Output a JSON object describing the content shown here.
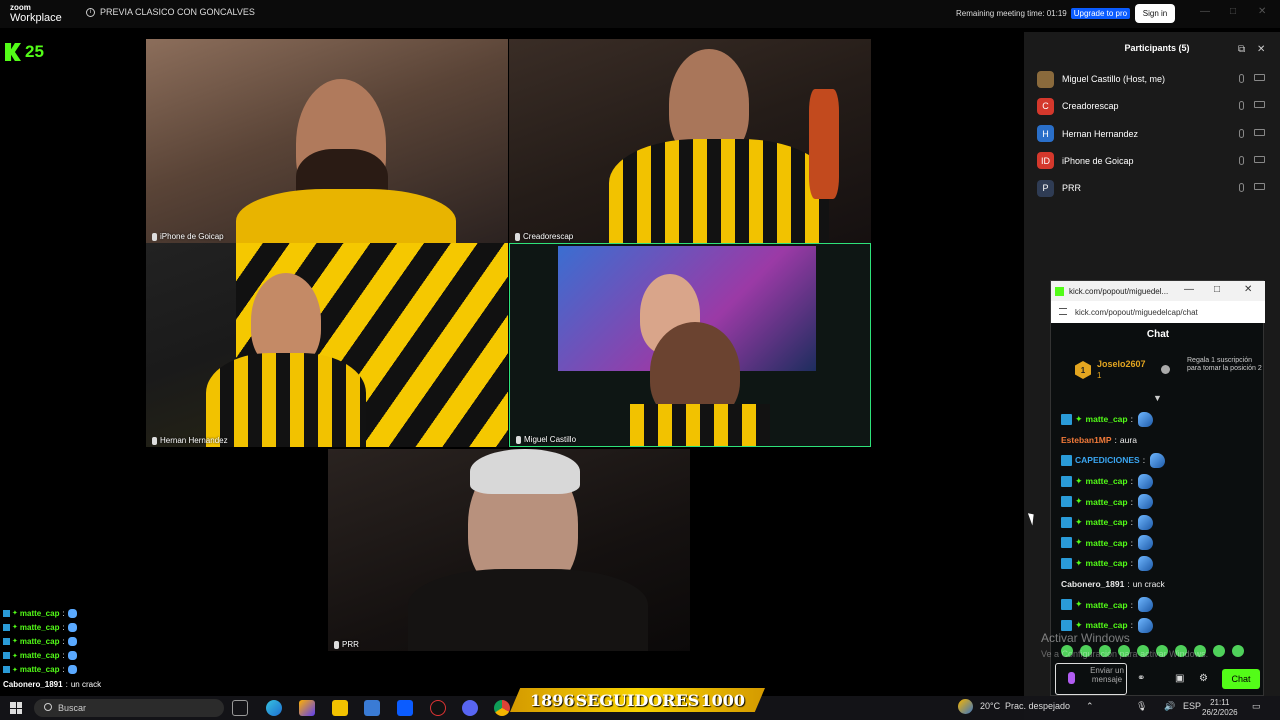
{
  "zoom": {
    "logo_top": "zoom",
    "logo_bottom": "Workplace",
    "meeting_title": "PREVIA CLASICO CON GONCALVES",
    "remaining": "Remaining meeting time: 01:19",
    "upgrade": "Upgrade to pro",
    "sign_in": "Sign in"
  },
  "overlay": {
    "kick_count": "25",
    "banner_left": "1896",
    "banner_middle": "SEGUIDORES",
    "banner_right": "1000"
  },
  "tiles": [
    {
      "name": "iPhone de Goicap"
    },
    {
      "name": "Creadorescap"
    },
    {
      "name": "Hernan Hernandez"
    },
    {
      "name": "Miguel Castillo"
    },
    {
      "name": "PRR"
    }
  ],
  "participants": {
    "title": "Participants (5)",
    "list": [
      {
        "name": "Miguel Castillo (Host, me)",
        "avatar": "",
        "color": "#8a6a3c"
      },
      {
        "name": "Creadorescap",
        "avatar": "C",
        "color": "#d4382c"
      },
      {
        "name": "Hernan Hernandez",
        "avatar": "H",
        "color": "#2a6fc9"
      },
      {
        "name": "iPhone de Goicap",
        "avatar": "ID",
        "color": "#d4382c"
      },
      {
        "name": "PRR",
        "avatar": "P",
        "color": "#2f3c54"
      }
    ]
  },
  "kick_popup": {
    "window_title": "kick.com/popout/miguedel...",
    "url": "kick.com/popout/miguedelcap/chat",
    "chat_title": "Chat",
    "pinned": {
      "rank": "1",
      "user": "Joselo2607",
      "count": "1",
      "gift_text": "Regala 1 suscripción para tomar la posición 2"
    },
    "messages": [
      {
        "user": "matte_cap",
        "color": "#53fc18",
        "text": "",
        "mod": true,
        "sub": true,
        "emote": true
      },
      {
        "user": "Esteban1MP",
        "color": "#f27a3a",
        "text": "aura",
        "mod": false,
        "sub": false,
        "emote": false
      },
      {
        "user": "CAPEDICIONES",
        "color": "#3aa6f2",
        "text": "",
        "mod": true,
        "sub": false,
        "emote": true
      },
      {
        "user": "matte_cap",
        "color": "#53fc18",
        "text": "",
        "mod": true,
        "sub": true,
        "emote": true
      },
      {
        "user": "matte_cap",
        "color": "#53fc18",
        "text": "",
        "mod": true,
        "sub": true,
        "emote": true
      },
      {
        "user": "matte_cap",
        "color": "#53fc18",
        "text": "",
        "mod": true,
        "sub": true,
        "emote": true
      },
      {
        "user": "matte_cap",
        "color": "#53fc18",
        "text": "",
        "mod": true,
        "sub": true,
        "emote": true
      },
      {
        "user": "matte_cap",
        "color": "#53fc18",
        "text": "",
        "mod": true,
        "sub": true,
        "emote": true
      },
      {
        "user": "Cabonero_1891",
        "color": "#e8e8e8",
        "text": "un crack",
        "mod": false,
        "sub": false,
        "emote": false
      },
      {
        "user": "matte_cap",
        "color": "#53fc18",
        "text": "",
        "mod": true,
        "sub": true,
        "emote": true
      },
      {
        "user": "matte_cap",
        "color": "#53fc18",
        "text": "",
        "mod": true,
        "sub": true,
        "emote": true
      }
    ],
    "input_placeholder": "Enviar un mensaje",
    "chat_button": "Chat"
  },
  "mini_chat": [
    {
      "user": "matte_cap",
      "text": ""
    },
    {
      "user": "matte_cap",
      "text": ""
    },
    {
      "user": "matte_cap",
      "text": ""
    },
    {
      "user": "matte_cap",
      "text": ""
    },
    {
      "user": "matte_cap",
      "text": ""
    },
    {
      "user": "Cabonero_1891",
      "text": "un crack"
    }
  ],
  "windows": {
    "activate_title": "Activar Windows",
    "activate_sub": "Ve a Configuración para activar Windows.",
    "search": "Buscar",
    "weather": "20°C",
    "weather_desc": "Prac. despejado",
    "lang": "ESP",
    "time": "21:11",
    "date": "26/2/2026"
  }
}
